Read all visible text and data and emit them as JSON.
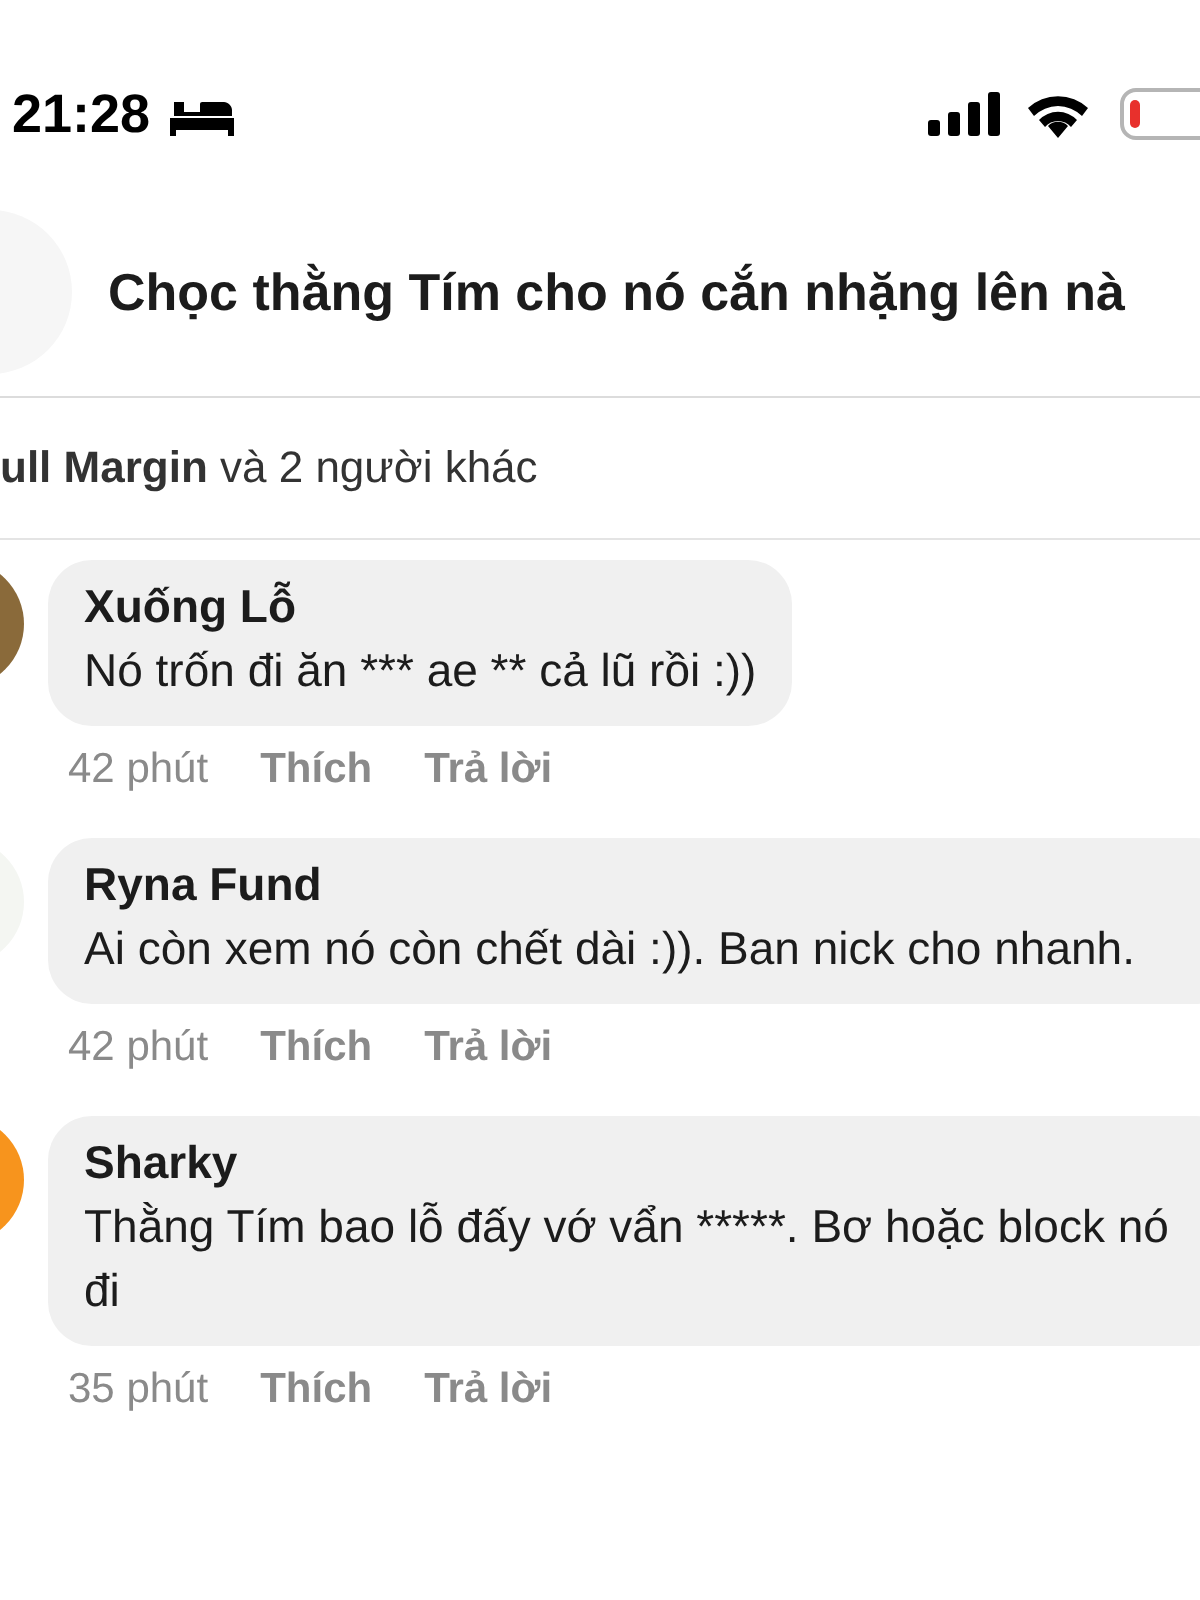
{
  "status_bar": {
    "time": "21:28"
  },
  "header": {
    "title": "Chọc thằng Tím cho nó cắn nhặng lên nà"
  },
  "reactions": {
    "text": "**ull Margin** và 2 người khác"
  },
  "comments": [
    {
      "author": "Xuống Lỗ",
      "text": "Nó trốn đi ăn *** ae ** cả lũ rồi :))",
      "time": "42 phút",
      "like": "Thích",
      "reply": "Trả lời"
    },
    {
      "author": "Ryna Fund",
      "text": "Ai còn xem nó còn chết dài :)). Ban nick cho nhanh.",
      "time": "42 phút",
      "like": "Thích",
      "reply": "Trả lời"
    },
    {
      "author": "Sharky",
      "text": "Thằng Tím bao lỗ đấy vớ vẩn *****. Bơ hoặc block nó đi",
      "time": "35 phút",
      "like": "Thích",
      "reply": "Trả lời"
    }
  ]
}
